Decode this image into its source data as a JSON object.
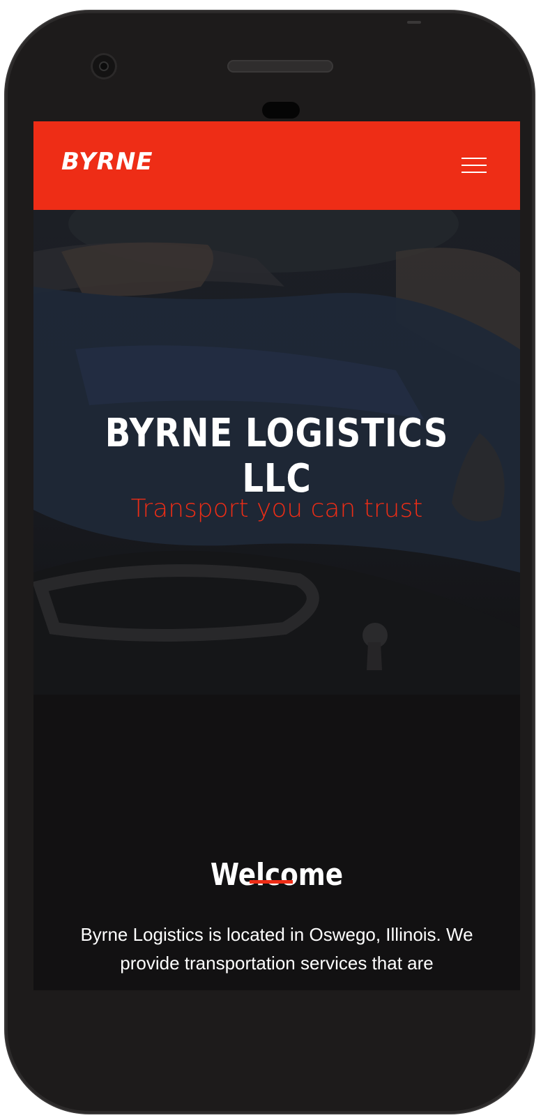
{
  "header": {
    "logo": "BYRNE",
    "menu_icon": "hamburger-menu-icon"
  },
  "hero": {
    "title": "BYRNE LOGISTICS LLC",
    "subtitle": "Transport you can trust"
  },
  "welcome": {
    "title": "Welcome",
    "text": "Byrne Logistics is located in Oswego, Illinois. We provide transportation services that are"
  },
  "colors": {
    "brand": "#ee2d16",
    "background": "#121112",
    "text": "#ffffff"
  }
}
